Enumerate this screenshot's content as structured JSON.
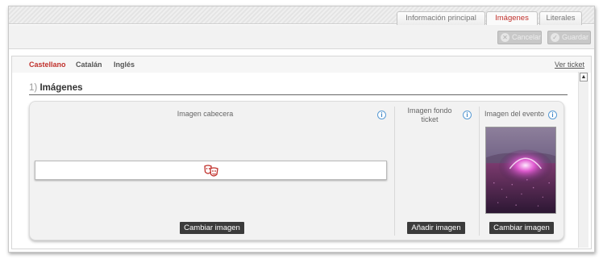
{
  "tabs": [
    {
      "label": "Información principal",
      "active": false
    },
    {
      "label": "Imágenes",
      "active": true
    },
    {
      "label": "Literales",
      "active": false
    }
  ],
  "toolbar": {
    "cancel_label": "Cancelar",
    "save_label": "Guardar",
    "cancel_icon": "x-circle-icon",
    "save_icon": "check-circle-icon"
  },
  "languages": [
    {
      "label": "Castellano",
      "active": true
    },
    {
      "label": "Catalán",
      "active": false
    },
    {
      "label": "Inglés",
      "active": false
    }
  ],
  "view_ticket_link": "Ver ticket",
  "section": {
    "number": "1)",
    "title": "Imágenes"
  },
  "columns": {
    "header_image": {
      "label": "Imagen cabecera",
      "button": "Cambiar imagen"
    },
    "background_image": {
      "label": "Imagen fondo ticket",
      "button": "Añadir imagen"
    },
    "event_image": {
      "label": "Imagen del evento",
      "button": "Cambiar imagen"
    }
  },
  "info_icon_glyph": "i",
  "colors": {
    "accent": "#c0302b",
    "info": "#3b84c4",
    "button_dark": "#3b3b3b"
  }
}
